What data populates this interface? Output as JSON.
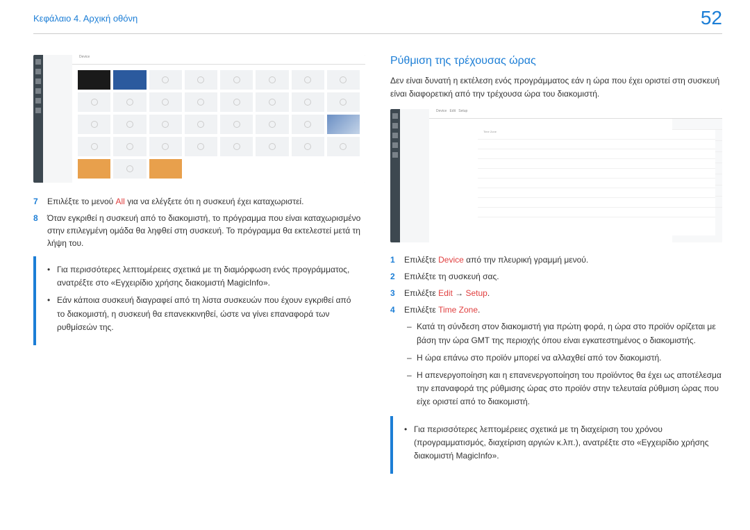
{
  "header": {
    "breadcrumb": "Κεφάλαιο 4. Αρχική οθόνη",
    "page_number": "52"
  },
  "left": {
    "steps": [
      {
        "n": "7",
        "prefix": "Επιλέξτε το μενού ",
        "hl": "All",
        "suffix": " για να ελέγξετε ότι η συσκευή έχει καταχωριστεί."
      },
      {
        "n": "8",
        "text": "Όταν εγκριθεί η συσκευή από το διακομιστή, το πρόγραμμα που είναι καταχωρισμένο στην επιλεγμένη ομάδα θα ληφθεί στη συσκευή. Το πρόγραμμα θα εκτελεστεί μετά τη λήψη του."
      }
    ],
    "note": {
      "items": [
        "Για περισσότερες λεπτομέρειες σχετικά με τη διαμόρφωση ενός προγράμματος, ανατρέξτε στο «Εγχειρίδιο χρήσης διακομιστή MagicInfo».",
        "Εάν κάποια συσκευή διαγραφεί από τη λίστα συσκευών που έχουν εγκριθεί από το διακομιστή, η συσκευή θα επανεκκινηθεί, ώστε να γίνει επαναφορά των ρυθμίσεών της."
      ]
    }
  },
  "right": {
    "title": "Ρύθμιση της τρέχουσας ώρας",
    "intro": "Δεν είναι δυνατή η εκτέλεση ενός προγράμματος εάν η ώρα που έχει οριστεί στη συσκευή είναι διαφορετική από την τρέχουσα ώρα του διακομιστή.",
    "steps": [
      {
        "n": "1",
        "prefix": "Επιλέξτε ",
        "hl": "Device",
        "suffix": " από την πλευρική γραμμή μενού."
      },
      {
        "n": "2",
        "text": "Επιλέξτε τη συσκευή σας."
      },
      {
        "n": "3",
        "prefix": "Επιλέξτε ",
        "hl": "Edit",
        "mid": " → ",
        "hl2": "Setup",
        "suffix2": "."
      },
      {
        "n": "4",
        "prefix": "Επιλέξτε ",
        "hl": "Time Zone",
        "suffix": "."
      }
    ],
    "subbullets": [
      "Κατά τη σύνδεση στον διακομιστή για πρώτη φορά, η ώρα στο προϊόν ορίζεται με βάση την ώρα GMT της περιοχής όπου είναι εγκατεστημένος ο διακομιστής.",
      "Η ώρα επάνω στο προϊόν μπορεί να αλλαχθεί από τον διακομιστή.",
      "Η απενεργοποίηση και η επανενεργοποίηση του προϊόντος θα έχει ως αποτέλεσμα την επαναφορά της ρύθμισης ώρας στο προϊόν στην τελευταία ρύθμιση ώρας που είχε οριστεί από το διακομιστή."
    ],
    "note": {
      "items": [
        "Για περισσότερες λεπτομέρειες σχετικά με τη διαχείριση του χρόνου (προγραμματισμός, διαχείριση αργιών κ.λπ.), ανατρέξτε στο «Εγχειρίδιο χρήσης διακομιστή MagicInfo»."
      ]
    }
  }
}
